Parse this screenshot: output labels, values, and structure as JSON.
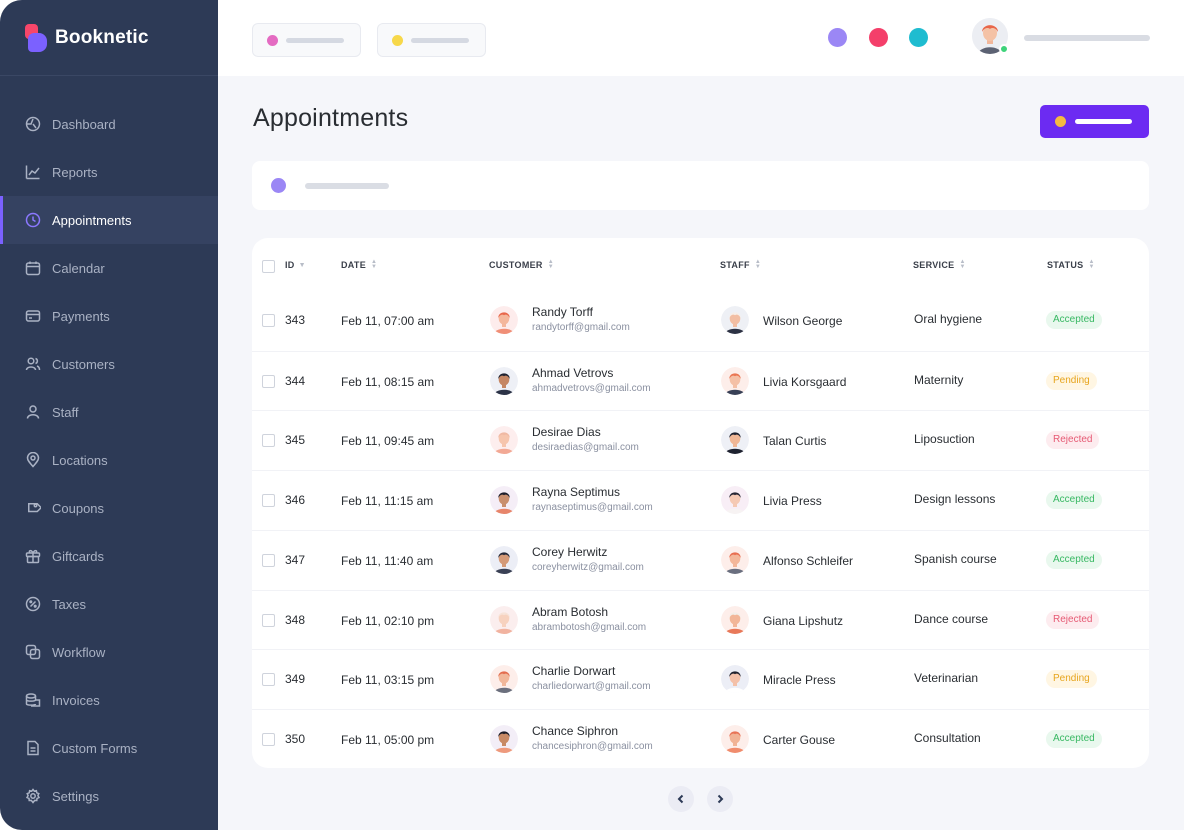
{
  "app": {
    "name": "Booknetic"
  },
  "sidebar": {
    "items": [
      {
        "label": "Dashboard",
        "icon": "dashboard-icon"
      },
      {
        "label": "Reports",
        "icon": "reports-icon"
      },
      {
        "label": "Appointments",
        "icon": "clock-icon",
        "active": true
      },
      {
        "label": "Calendar",
        "icon": "calendar-icon"
      },
      {
        "label": "Payments",
        "icon": "credit-card-icon"
      },
      {
        "label": "Customers",
        "icon": "users-icon"
      },
      {
        "label": "Staff",
        "icon": "user-icon"
      },
      {
        "label": "Locations",
        "icon": "location-pin-icon"
      },
      {
        "label": "Coupons",
        "icon": "tag-icon"
      },
      {
        "label": "Giftcards",
        "icon": "gift-icon"
      },
      {
        "label": "Taxes",
        "icon": "percent-icon"
      },
      {
        "label": "Workflow",
        "icon": "workflow-icon"
      },
      {
        "label": "Invoices",
        "icon": "invoice-icon"
      },
      {
        "label": "Custom Forms",
        "icon": "form-icon"
      },
      {
        "label": "Settings",
        "icon": "gear-icon"
      }
    ]
  },
  "colors": {
    "accent": "#6c2bf2",
    "sidebar_bg": "#2d3a56",
    "status_accepted": "#38b863",
    "status_pending": "#e7a51e",
    "status_rejected": "#e65a74",
    "top_dots": [
      "#9b87f5",
      "#f43f6a",
      "#1fbcd0"
    ]
  },
  "main": {
    "title": "Appointments",
    "table": {
      "columns": [
        "ID",
        "DATE",
        "CUSTOMER",
        "STAFF",
        "SERVICE",
        "STATUS"
      ],
      "rows": [
        {
          "id": "343",
          "date": "Feb 11, 07:00 am",
          "customer": "Randy Torff",
          "email": "randytorff@gmail.com",
          "staff": "Wilson George",
          "service": "Oral hygiene",
          "status": "Accepted"
        },
        {
          "id": "344",
          "date": "Feb 11, 08:15 am",
          "customer": "Ahmad Vetrovs",
          "email": "ahmadvetrovs@gmail.com",
          "staff": "Livia Korsgaard",
          "service": "Maternity",
          "status": "Pending"
        },
        {
          "id": "345",
          "date": "Feb 11, 09:45 am",
          "customer": "Desirae Dias",
          "email": "desiraedias@gmail.com",
          "staff": "Talan Curtis",
          "service": "Liposuction",
          "status": "Rejected"
        },
        {
          "id": "346",
          "date": "Feb 11, 11:15 am",
          "customer": "Rayna Septimus",
          "email": "raynaseptimus@gmail.com",
          "staff": "Livia Press",
          "service": "Design lessons",
          "status": "Accepted"
        },
        {
          "id": "347",
          "date": "Feb 11, 11:40 am",
          "customer": "Corey Herwitz",
          "email": "coreyherwitz@gmail.com",
          "staff": "Alfonso Schleifer",
          "service": "Spanish course",
          "status": "Accepted"
        },
        {
          "id": "348",
          "date": "Feb 11, 02:10 pm",
          "customer": "Abram Botosh",
          "email": "abrambotosh@gmail.com",
          "staff": "Giana Lipshutz",
          "service": "Dance course",
          "status": "Rejected"
        },
        {
          "id": "349",
          "date": "Feb 11, 03:15 pm",
          "customer": "Charlie Dorwart",
          "email": "charliedorwart@gmail.com",
          "staff": "Miracle Press",
          "service": "Veterinarian",
          "status": "Pending"
        },
        {
          "id": "350",
          "date": "Feb 11, 05:00 pm",
          "customer": "Chance Siphron",
          "email": "chancesiphron@gmail.com",
          "staff": "Carter Gouse",
          "service": "Consultation",
          "status": "Accepted"
        }
      ]
    }
  }
}
